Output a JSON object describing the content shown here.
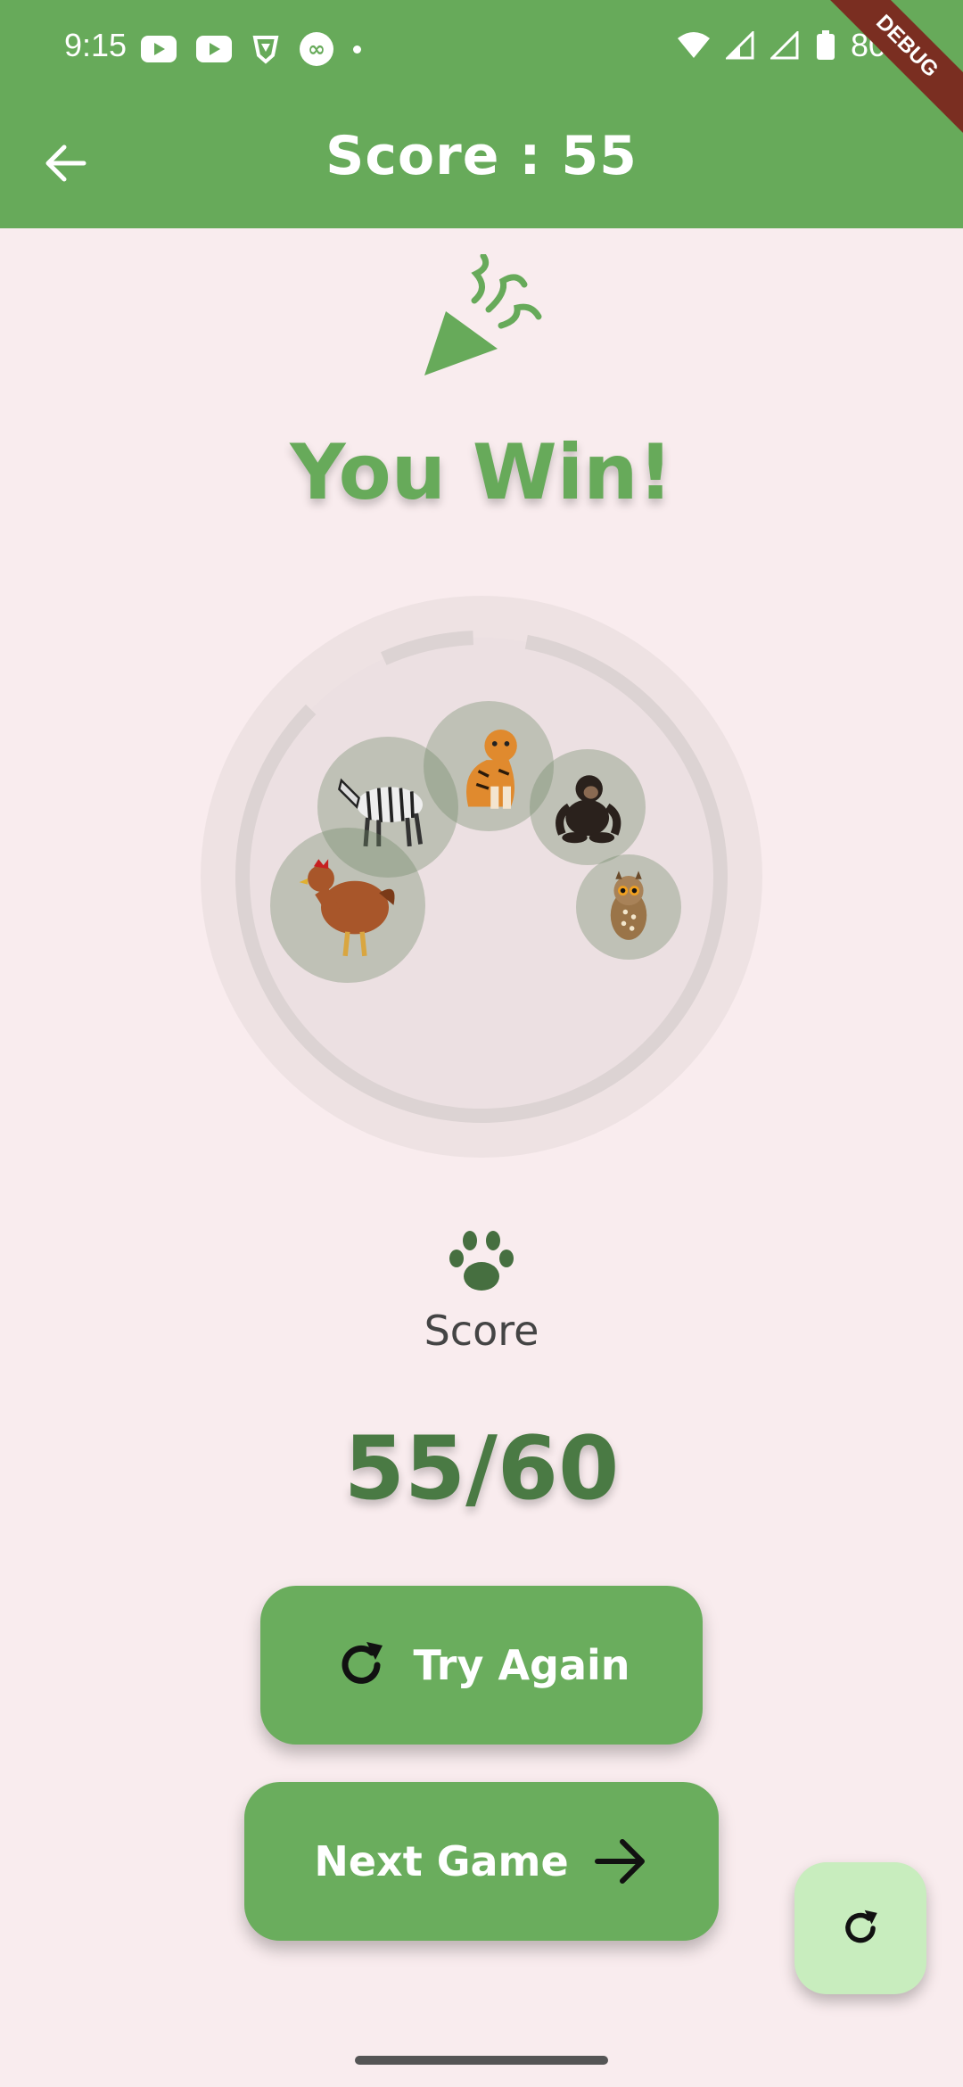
{
  "status_bar": {
    "time": "9:15",
    "battery": "80%",
    "debug_banner": "DEBUG"
  },
  "app_bar": {
    "title_prefix": "Score :",
    "title_score": "55",
    "back_icon": "arrow-left-icon"
  },
  "result": {
    "icon": "party-popper-icon",
    "heading": "You Win!"
  },
  "animals": [
    "zebra",
    "tiger",
    "chimpanzee",
    "chicken",
    "owl"
  ],
  "score_section": {
    "icon": "paw-icon",
    "label": "Score",
    "value": "55/60"
  },
  "buttons": {
    "try_again": "Try Again",
    "next_game": "Next Game"
  },
  "colors": {
    "primary": "#67aa5a",
    "background": "#f9ecee",
    "score_text": "#4a7a44",
    "fab": "#c8edbe"
  }
}
